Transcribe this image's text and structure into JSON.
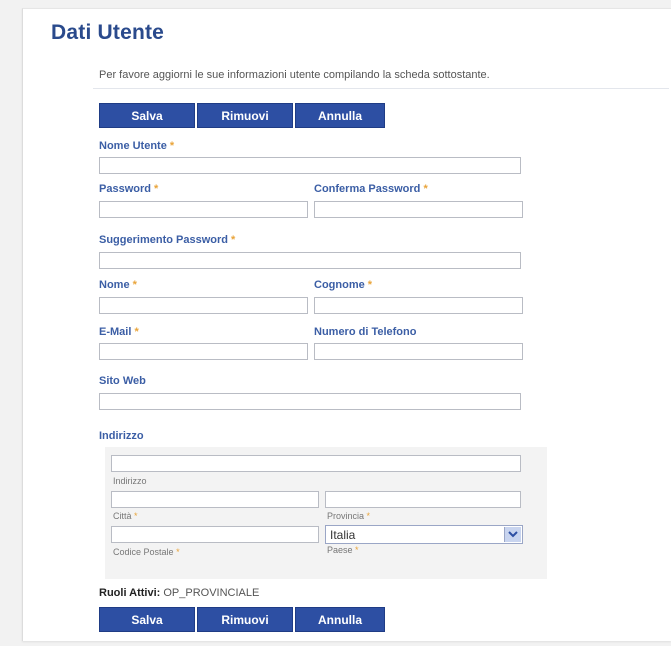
{
  "page": {
    "title": "Dati Utente",
    "intro": "Per favore aggiorni le sue informazioni utente compilando la scheda sottostante."
  },
  "toolbar": {
    "save_label": "Salva",
    "remove_label": "Rimuovi",
    "cancel_label": "Annulla"
  },
  "form": {
    "required_mark": "*",
    "username": {
      "label": "Nome Utente",
      "value": ""
    },
    "password": {
      "label": "Password",
      "value": ""
    },
    "confirm_password": {
      "label": "Conferma Password",
      "value": ""
    },
    "password_hint": {
      "label": "Suggerimento Password",
      "value": ""
    },
    "first_name": {
      "label": "Nome",
      "value": ""
    },
    "last_name": {
      "label": "Cognome",
      "value": ""
    },
    "email": {
      "label": "E-Mail",
      "value": ""
    },
    "phone": {
      "label": "Numero di Telefono",
      "value": ""
    },
    "website": {
      "label": "Sito Web",
      "value": ""
    }
  },
  "address": {
    "section_label": "Indirizzo",
    "street": {
      "label": "Indirizzo",
      "value": ""
    },
    "city": {
      "label": "Città",
      "value": ""
    },
    "province": {
      "label": "Provincia",
      "value": ""
    },
    "postal_code": {
      "label": "Codice Postale",
      "value": ""
    },
    "country": {
      "label": "Paese",
      "value": "Italia"
    }
  },
  "roles": {
    "label": "Ruoli Attivi:",
    "value": "OP_PROVINCIALE"
  },
  "colors": {
    "accent": "#2d4fa3",
    "label": "#3b5ea5",
    "required": "#e9a43a"
  },
  "icons": {
    "select_arrow": "chevron-down-icon"
  }
}
